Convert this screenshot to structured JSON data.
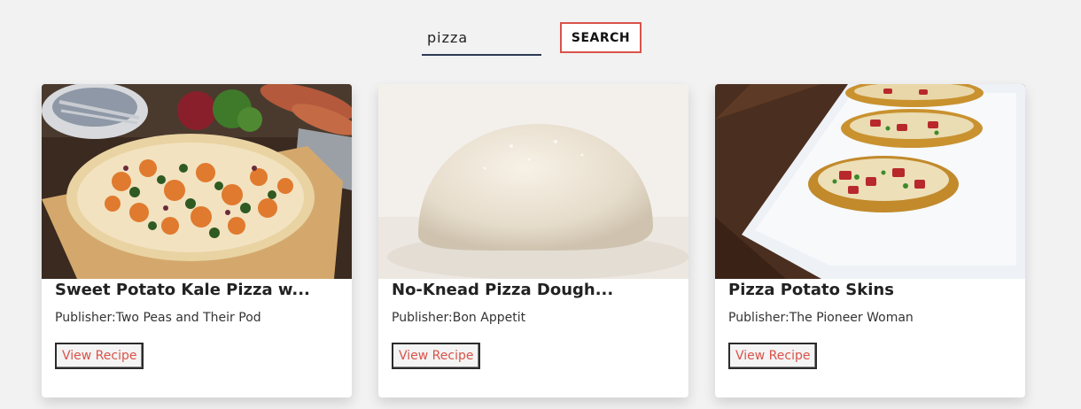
{
  "search": {
    "value": "pizza",
    "button_label": "SEARCH"
  },
  "recipes": [
    {
      "title": "Sweet Potato Kale Pizza w...",
      "publisher": "Publisher:Two Peas and Their Pod",
      "button_label": "View Recipe",
      "image": "sweet-potato-kale-pizza-photo"
    },
    {
      "title": "No-Knead Pizza Dough...",
      "publisher": "Publisher:Bon Appetit",
      "button_label": "View Recipe",
      "image": "pizza-dough-photo"
    },
    {
      "title": "Pizza Potato Skins",
      "publisher": "Publisher:The Pioneer Woman",
      "button_label": "View Recipe",
      "image": "pizza-potato-skins-photo"
    }
  ],
  "colors": {
    "accent": "#d9534a",
    "underline": "#2c3a55",
    "background": "#f2f2f2"
  }
}
